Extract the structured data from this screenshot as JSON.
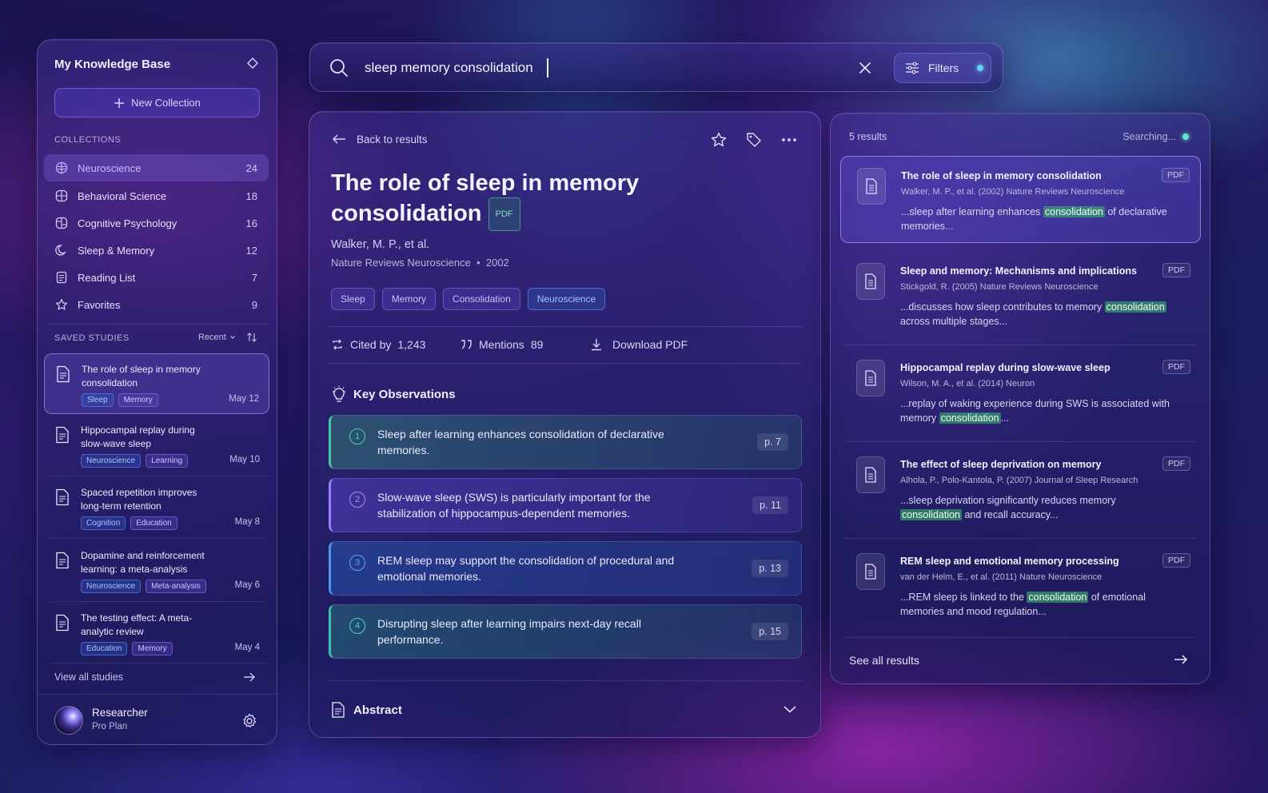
{
  "sidebar": {
    "title": "My Knowledge Base",
    "new_collection": "New Collection",
    "collections_label": "COLLECTIONS",
    "collections": [
      {
        "label": "Neuroscience",
        "count": "24",
        "icon": "brain-icon"
      },
      {
        "label": "Behavioral Science",
        "count": "18",
        "icon": "brain-icon"
      },
      {
        "label": "Cognitive Psychology",
        "count": "16",
        "icon": "brain-icon"
      },
      {
        "label": "Sleep & Memory",
        "count": "12",
        "icon": "moon-icon"
      },
      {
        "label": "Reading List",
        "count": "7",
        "icon": "list-icon"
      },
      {
        "label": "Favorites",
        "count": "9",
        "icon": "star-icon"
      }
    ],
    "saved_label": "SAVED STUDIES",
    "sort_label": "Recent",
    "studies": [
      {
        "title": "The role of sleep in memory consolidation",
        "tags": [
          "Sleep",
          "Memory"
        ],
        "date": "May 12"
      },
      {
        "title": "Hippocampal replay during slow-wave sleep",
        "tags": [
          "Neuroscience",
          "Learning"
        ],
        "date": "May 10"
      },
      {
        "title": "Spaced repetition improves long-term retention",
        "tags": [
          "Cognition",
          "Education"
        ],
        "date": "May 8"
      },
      {
        "title": "Dopamine and reinforcement learning: a meta-analysis",
        "tags": [
          "Neuroscience",
          "Meta-analysis"
        ],
        "date": "May 6"
      },
      {
        "title": "The testing effect: A meta-analytic review",
        "tags": [
          "Education",
          "Memory"
        ],
        "date": "May 4"
      }
    ],
    "view_all": "View all studies",
    "user": {
      "name": "Researcher",
      "plan": "Pro Plan"
    }
  },
  "search": {
    "query": "sleep memory consolidation",
    "filters_label": "Filters"
  },
  "detail": {
    "back_label": "Back to results",
    "title": "The role of sleep in memory consolidation",
    "badge": "PDF",
    "authors": "Walker, M. P., et al.",
    "journal": "Nature Reviews Neuroscience",
    "year": "2002",
    "tags": [
      "Sleep",
      "Memory",
      "Consolidation",
      "Neuroscience"
    ],
    "cited_label": "Cited by",
    "cited_count": "1,243",
    "mentions_label": "Mentions",
    "mentions_count": "89",
    "download_label": "Download PDF",
    "observations_title": "Key Observations",
    "observations": [
      {
        "num": "1",
        "text": "Sleep after learning enhances consolidation of declarative memories.",
        "page": "p. 7"
      },
      {
        "num": "2",
        "text": "Slow-wave sleep (SWS) is particularly important for the stabilization of hippocampus-dependent memories.",
        "page": "p. 11"
      },
      {
        "num": "3",
        "text": "REM sleep may support the consolidation of procedural and emotional memories.",
        "page": "p. 13"
      },
      {
        "num": "4",
        "text": "Disrupting sleep after learning impairs next-day recall performance.",
        "page": "p. 15"
      }
    ],
    "abstract_label": "Abstract"
  },
  "results": {
    "count_label": "5 results",
    "status": "Searching...",
    "items": [
      {
        "title": "The role of sleep in memory consolidation",
        "meta": "Walker, M. P., et al. (2002)  Nature Reviews Neuroscience",
        "pre": "...sleep after learning enhances ",
        "hl": "consolidation",
        "post": " of declarative memories...",
        "badge": "PDF"
      },
      {
        "title": "Sleep and memory: Mechanisms and implications",
        "meta": "Stickgold, R. (2005)  Nature Reviews Neuroscience",
        "pre": "...discusses how sleep contributes to memory ",
        "hl": "consolidation",
        "post": " across multiple stages...",
        "badge": "PDF"
      },
      {
        "title": "Hippocampal replay during slow-wave sleep",
        "meta": "Wilson, M. A., et al. (2014)  Neuron",
        "pre": "...replay of waking experience during SWS is associated with memory ",
        "hl": "consolidation",
        "post": "...",
        "badge": "PDF"
      },
      {
        "title": "The effect of sleep deprivation on memory",
        "meta": "Alhola, P., Polo-Kantola, P. (2007)  Journal of Sleep Research",
        "pre": "...sleep deprivation significantly reduces memory ",
        "hl": "consolidation",
        "post": " and recall accuracy...",
        "badge": "PDF"
      },
      {
        "title": "REM sleep and emotional memory processing",
        "meta": "van der Helm, E., et al. (2011)  Nature Neuroscience",
        "pre": "...REM sleep is linked to the ",
        "hl": "consolidation",
        "post": " of emotional memories and mood regulation...",
        "badge": "PDF"
      }
    ],
    "see_all": "See all results"
  }
}
